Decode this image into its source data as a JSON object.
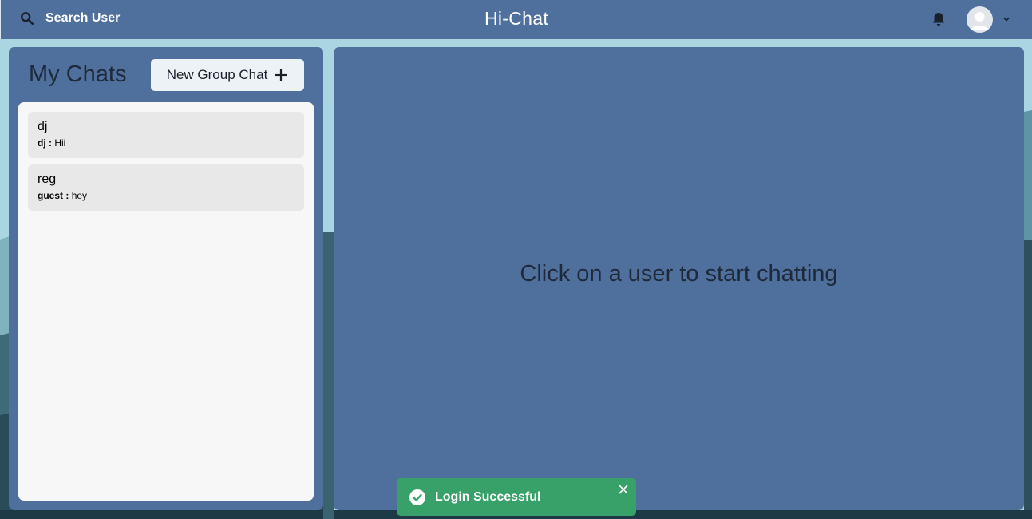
{
  "header": {
    "search_label": "Search User",
    "app_title": "Hi-Chat",
    "icons": [
      "search-icon",
      "bell-icon",
      "avatar-icon",
      "chevron-down-icon"
    ]
  },
  "chats_panel": {
    "title": "My Chats",
    "new_group_label": "New Group Chat",
    "chats": [
      {
        "name": "dj",
        "sender": "dj :",
        "message": "Hii"
      },
      {
        "name": "reg",
        "sender": "guest :",
        "message": "hey"
      }
    ]
  },
  "chat_area": {
    "empty_message": "Click on a user to start chatting"
  },
  "toast": {
    "message": "Login Successful",
    "status": "success"
  },
  "colors": {
    "panel": "#4f6f9c",
    "toast": "#38a169",
    "chat_item": "#e8e8e8"
  }
}
